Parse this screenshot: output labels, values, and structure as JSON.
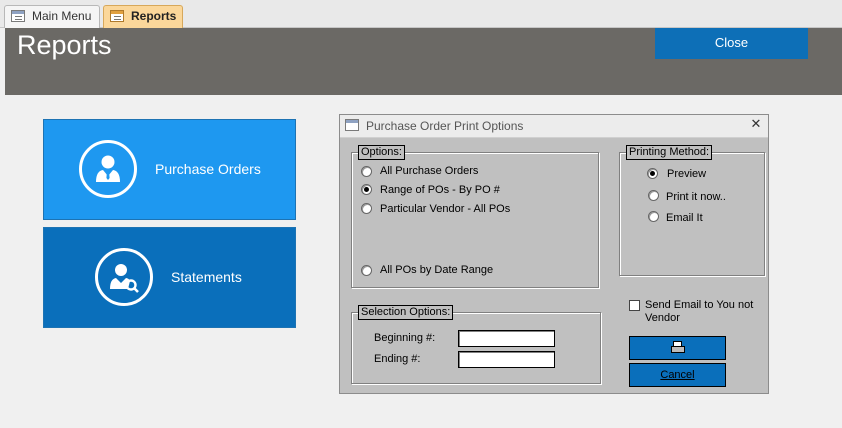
{
  "tabs": [
    {
      "label": "Main Menu",
      "icon": "form-icon",
      "active": false
    },
    {
      "label": "Reports",
      "icon": "form-icon",
      "active": true
    }
  ],
  "header": {
    "title": "Reports",
    "close_label": "Close",
    "background": "#6b6965",
    "accent": "#0d6fb7"
  },
  "tiles": {
    "purchase_orders": {
      "label": "Purchase Orders",
      "icon": "person-icon",
      "color": "#1e98f0"
    },
    "statements": {
      "label": "Statements",
      "icon": "person-search-icon",
      "color": "#0a6fbb"
    }
  },
  "dialog": {
    "title": "Purchase Order Print Options",
    "close_glyph": "✕",
    "options": {
      "legend": "Options:",
      "items": [
        {
          "label": "All Purchase Orders",
          "selected": false
        },
        {
          "label": "Range of POs - By PO #",
          "selected": true
        },
        {
          "label": "Particular Vendor - All POs",
          "selected": false
        },
        {
          "label": "All POs by Date Range",
          "selected": false
        }
      ]
    },
    "printing_method": {
      "legend": "Printing Method:",
      "items": [
        {
          "label": "Preview",
          "selected": true
        },
        {
          "label": "Print it now..",
          "selected": false
        },
        {
          "label": "Email It",
          "selected": false
        }
      ]
    },
    "selection_options": {
      "legend": "Selection Options:",
      "beginning_label": "Beginning #:",
      "beginning_value": "",
      "ending_label": "Ending #:",
      "ending_value": ""
    },
    "send_email": {
      "label": "Send Email to You not Vendor",
      "checked": false
    },
    "print_button_icon": "printer-icon",
    "cancel_label": "Cancel"
  }
}
